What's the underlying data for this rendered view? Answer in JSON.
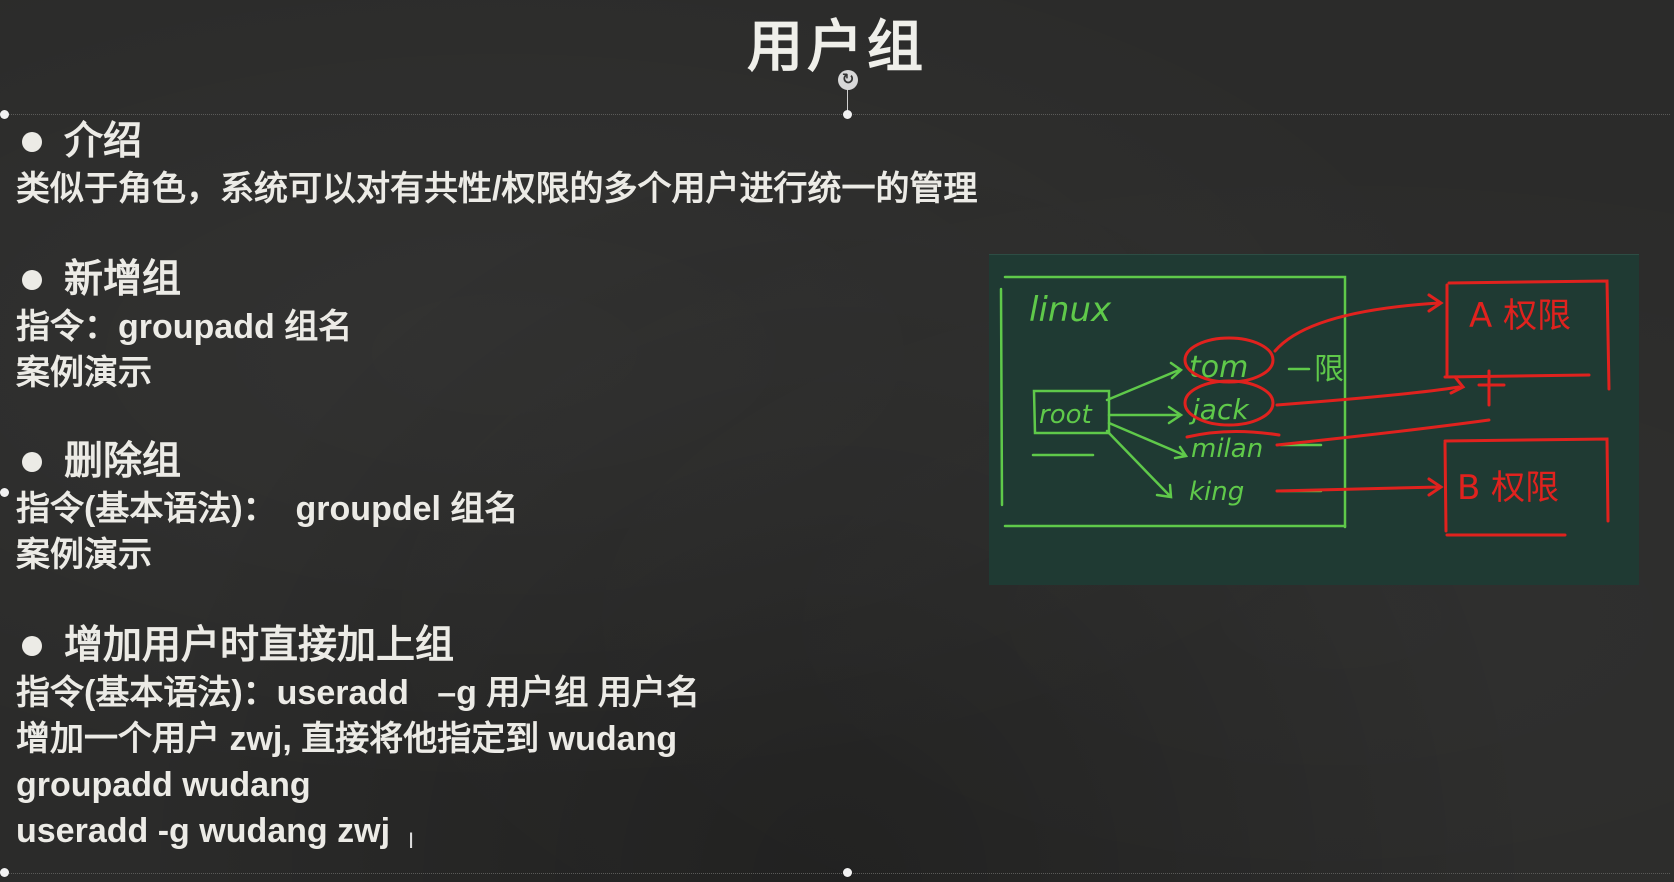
{
  "slide": {
    "title": "用户组",
    "sections": [
      {
        "heading": "介绍",
        "lines": [
          "类似于角色，系统可以对有共性/权限的多个用户进行统一的管理"
        ]
      },
      {
        "heading": "新增组",
        "lines": [
          "指令：groupadd 组名",
          "案例演示"
        ]
      },
      {
        "heading": "删除组",
        "lines": [
          "指令(基本语法)：  groupdel 组名",
          "案例演示"
        ]
      },
      {
        "heading": "增加用户时直接加上组",
        "lines": [
          "指令(基本语法)：useradd   –g 用户组 用户名",
          "增加一个用户 zwj, 直接将他指定到 wudang",
          "groupadd wudang",
          "useradd -g wudang zwj"
        ]
      }
    ]
  },
  "drawing": {
    "linux_label": "linux",
    "root_label": "root",
    "users": [
      "tom",
      "jack",
      "milan",
      "king"
    ],
    "tom_suffix": "限",
    "group_a_label": "A 权限",
    "group_b_label": "B 权限"
  },
  "colors": {
    "background": "#2b2b2a",
    "text": "#ecebe6",
    "drawing_bg": "#1f3a33",
    "pen_green": "#5fc94a",
    "pen_red": "#e0221e"
  }
}
